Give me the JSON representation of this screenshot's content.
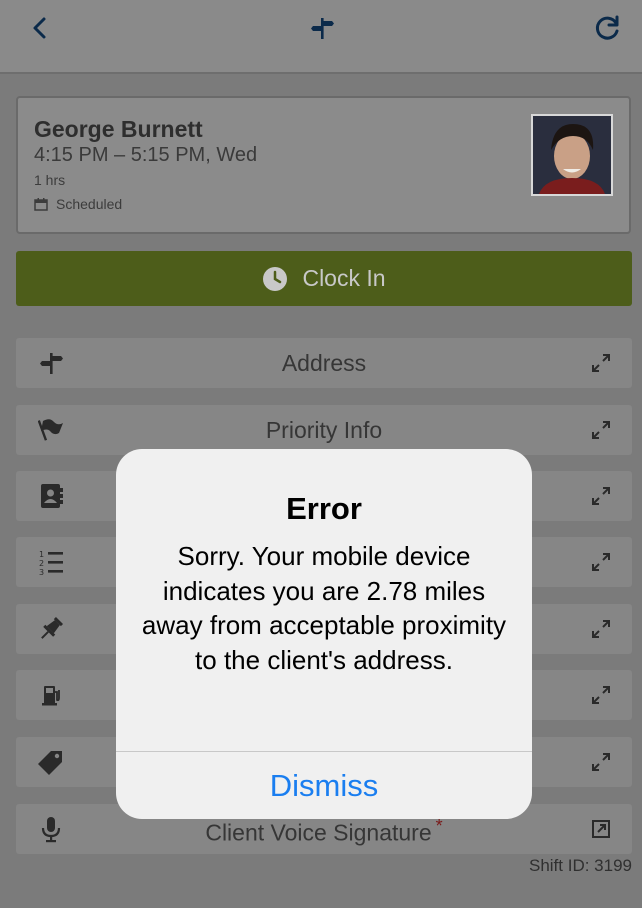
{
  "header": {
    "back_icon": "chevron-left-icon",
    "directions_icon": "signpost-icon",
    "refresh_icon": "refresh-icon"
  },
  "visit": {
    "client_name": "George Burnett",
    "time_range": "4:15 PM – 5:15 PM, Wed",
    "duration": "1 hrs",
    "status": "Scheduled"
  },
  "clock_in": {
    "label": "Clock In",
    "icon": "clock-icon",
    "color": "#4d5d1a"
  },
  "rows": [
    {
      "label": "Address",
      "icon": "signpost-icon"
    },
    {
      "label": "Priority Info",
      "icon": "flag-icon"
    },
    {
      "label": "",
      "icon": "contacts-icon"
    },
    {
      "label": "",
      "icon": "numbered-list-icon"
    },
    {
      "label": "",
      "icon": "pushpin-icon"
    },
    {
      "label": "",
      "icon": "fuel-icon"
    },
    {
      "label": "",
      "icon": "tag-icon"
    },
    {
      "label": "Client Voice Signature",
      "icon": "microphone-icon",
      "required": "*"
    }
  ],
  "shift_id": "Shift ID: 3199",
  "dialog": {
    "title": "Error",
    "message": "Sorry. Your mobile device indicates you are 2.78 miles away from acceptable proximity to the client's address.",
    "dismiss_label": "Dismiss",
    "accent_color": "#1a7ef0"
  }
}
